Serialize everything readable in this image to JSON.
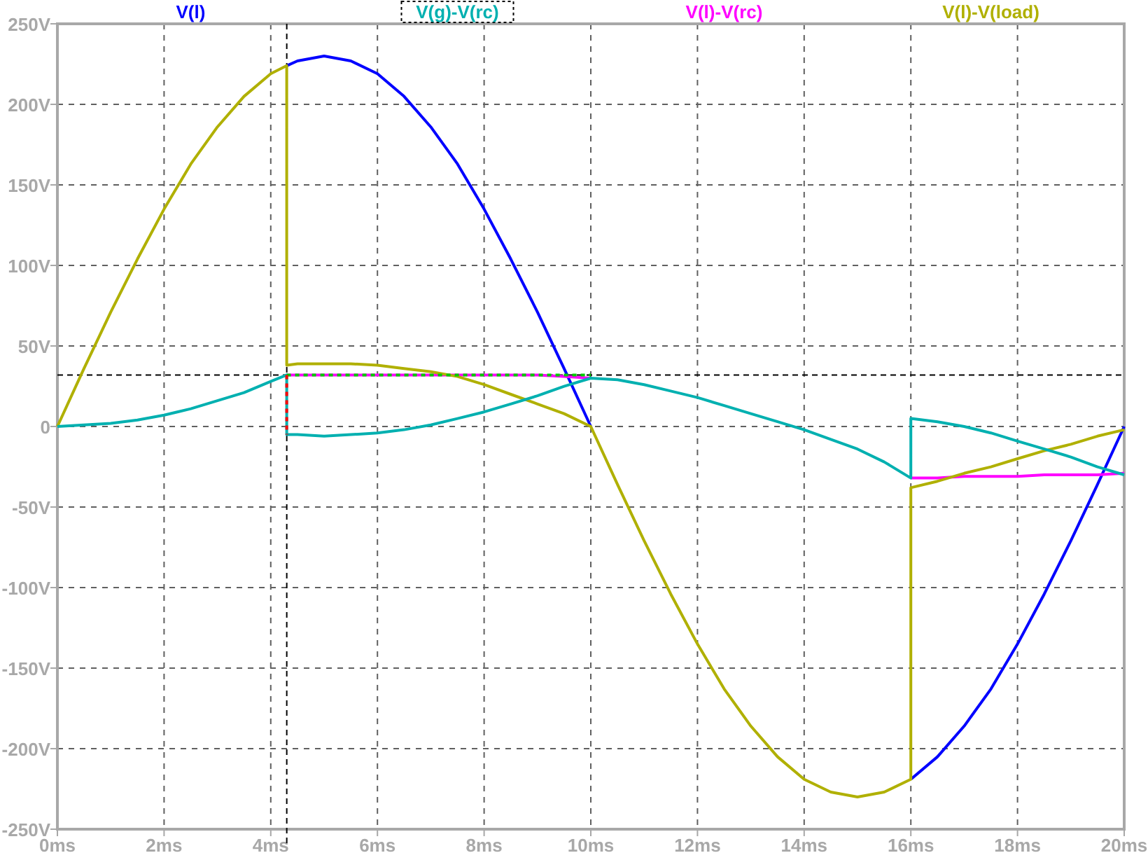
{
  "plot": {
    "legend": [
      {
        "selected": false
      },
      {
        "selected": true
      },
      {
        "selected": false
      },
      {
        "selected": false
      }
    ],
    "chart_data": {
      "type": "line",
      "grid": true,
      "x": [
        0,
        0.5,
        1,
        1.5,
        2,
        2.5,
        3,
        3.5,
        4,
        4.3,
        4.3,
        4.5,
        5,
        5.5,
        6,
        6.5,
        7,
        7.5,
        8,
        8.5,
        9,
        9.5,
        10,
        10.5,
        11,
        11.5,
        12,
        12.5,
        13,
        13.5,
        14,
        14.5,
        15,
        15.5,
        16,
        16,
        16.5,
        17,
        17.5,
        18,
        18.5,
        19,
        19.5,
        20
      ],
      "xlim": [
        0,
        20
      ],
      "ylim": [
        -250,
        250
      ],
      "xticks": [
        {
          "value": 0,
          "label": "0ms"
        },
        {
          "value": 2,
          "label": "2ms"
        },
        {
          "value": 4,
          "label": "4ms"
        },
        {
          "value": 6,
          "label": "6ms"
        },
        {
          "value": 8,
          "label": "8ms"
        },
        {
          "value": 10,
          "label": "10ms"
        },
        {
          "value": 12,
          "label": "12ms"
        },
        {
          "value": 14,
          "label": "14ms"
        },
        {
          "value": 16,
          "label": "16ms"
        },
        {
          "value": 18,
          "label": "18ms"
        },
        {
          "value": 20,
          "label": "20ms"
        }
      ],
      "yticks": [
        {
          "value": 250,
          "label": "250V"
        },
        {
          "value": 200,
          "label": "200V"
        },
        {
          "value": 150,
          "label": "150V"
        },
        {
          "value": 100,
          "label": "100V"
        },
        {
          "value": 50,
          "label": "50V"
        },
        {
          "value": 0,
          "label": "0"
        },
        {
          "value": -50,
          "label": "-50V"
        },
        {
          "value": -100,
          "label": "-100V"
        },
        {
          "value": -150,
          "label": "-150V"
        },
        {
          "value": -200,
          "label": "-200V"
        },
        {
          "value": -250,
          "label": "-250V"
        }
      ],
      "series": [
        {
          "name": "V(l)",
          "color": "#0000ff",
          "values": [
            null,
            null,
            null,
            null,
            null,
            null,
            null,
            null,
            null,
            224,
            224,
            227,
            230,
            227,
            219,
            205,
            186,
            163,
            135,
            104,
            71,
            36,
            0,
            null,
            null,
            null,
            null,
            null,
            null,
            null,
            null,
            null,
            null,
            null,
            -219,
            -219,
            -205,
            -186,
            -163,
            -135,
            -104,
            -71,
            -36,
            0
          ]
        },
        {
          "name": "V(g)-V(rc)",
          "color": "#00b0b0",
          "values": [
            0,
            1,
            2,
            4,
            7,
            11,
            16,
            21,
            28,
            32,
            -5,
            -5,
            -6,
            -5,
            -4,
            -2,
            1,
            5,
            9,
            14,
            19,
            25,
            30,
            29,
            26,
            22,
            18,
            13,
            8,
            3,
            -2,
            -8,
            -14,
            -22,
            -32,
            5,
            3,
            0,
            -4,
            -9,
            -14,
            -19,
            -25,
            -30
          ]
        },
        {
          "name": "V(l)-V(rc)",
          "color": "#ff00ff",
          "values": [
            null,
            null,
            null,
            null,
            null,
            null,
            null,
            null,
            null,
            null,
            32,
            32,
            32,
            32,
            32,
            32,
            32,
            32,
            32,
            32,
            32,
            31,
            30,
            null,
            null,
            null,
            null,
            null,
            null,
            null,
            null,
            null,
            null,
            null,
            -32,
            -32,
            -32,
            -31,
            -31,
            -31,
            -30,
            -30,
            -30,
            -29
          ]
        },
        {
          "color": "#ff0000",
          "line_style": "dashed",
          "values": [
            null,
            null,
            null,
            null,
            null,
            null,
            null,
            null,
            null,
            32,
            -5,
            null,
            null,
            null,
            null,
            null,
            null,
            null,
            null,
            null,
            null,
            null,
            null,
            null,
            null,
            null,
            null,
            null,
            null,
            null,
            null,
            null,
            null,
            null,
            null,
            null,
            null,
            null,
            null,
            null,
            null,
            null,
            null,
            null
          ]
        },
        {
          "color": "#00cc00",
          "line_style": "dashed",
          "values": [
            null,
            null,
            null,
            null,
            null,
            null,
            null,
            null,
            null,
            null,
            32,
            32,
            32,
            32,
            32,
            32,
            32,
            32,
            32,
            32,
            32,
            32,
            32,
            null,
            null,
            null,
            null,
            null,
            null,
            null,
            null,
            null,
            null,
            null,
            null,
            null,
            null,
            null,
            null,
            null,
            null,
            null,
            null,
            null
          ]
        },
        {
          "name": "V(l)-V(load)",
          "color": "#b0b000",
          "values": [
            0,
            36,
            71,
            104,
            135,
            163,
            186,
            205,
            219,
            224,
            38,
            39,
            39,
            39,
            38,
            36,
            34,
            31,
            26,
            20,
            14,
            8,
            0,
            -36,
            -71,
            -104,
            -135,
            -163,
            -186,
            -205,
            -219,
            -227,
            -230,
            -227,
            -219,
            -38,
            -34,
            -29,
            -25,
            -20,
            -15,
            -11,
            -6,
            -2
          ]
        }
      ],
      "ref_lines": [
        {
          "axis": "x",
          "value": 4.3
        },
        {
          "axis": "y",
          "value": 32
        }
      ]
    }
  }
}
